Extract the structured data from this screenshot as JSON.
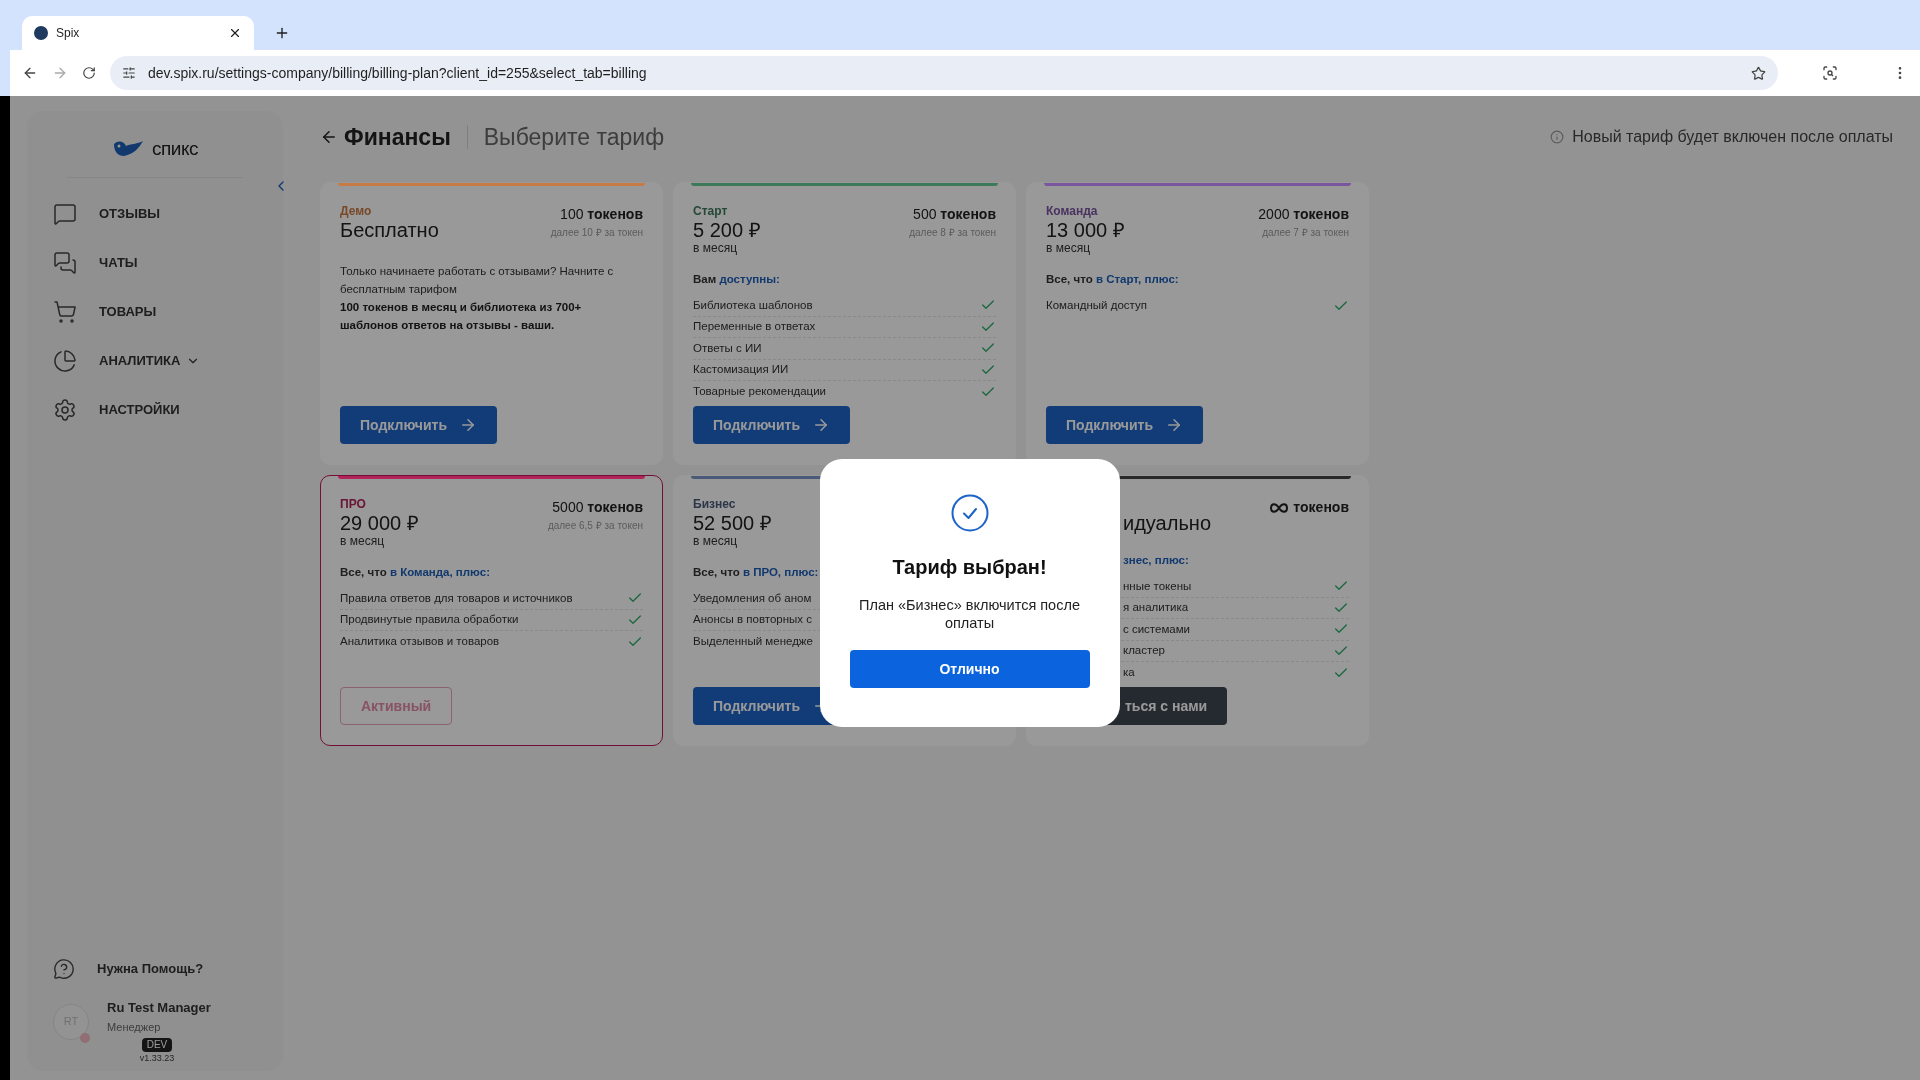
{
  "browser": {
    "tab_title": "Spix",
    "url": "dev.spix.ru/settings-company/billing/billing-plan?client_id=255&select_tab=billing"
  },
  "sidebar": {
    "logo": "спикс",
    "items": [
      {
        "label": "ОТЗЫВЫ",
        "expandable": false
      },
      {
        "label": "ЧАТЫ",
        "expandable": false
      },
      {
        "label": "ТОВАРЫ",
        "expandable": false
      },
      {
        "label": "АНАЛИТИКА",
        "expandable": true
      },
      {
        "label": "НАСТРОЙКИ",
        "expandable": false
      }
    ],
    "help": "Нужна Помощь?",
    "user": {
      "initials": "RT",
      "name": "Ru Test Manager",
      "role": "Менеджер"
    },
    "env": "DEV",
    "version": "v1.33.23"
  },
  "header": {
    "title": "Финансы",
    "subtitle": "Выберите тариф",
    "notice": "Новый тариф будет включен после оплаты"
  },
  "plans": [
    {
      "name": "Демо",
      "color": "#c87a45",
      "price": "Бесплатно",
      "tokens": "100",
      "tokens_label": "токенов",
      "rate": "далее 10 ₽ за токен",
      "description": "Только начинаете работать с отзывами? Начните с бесплатным тарифом",
      "description_bold": "100 токенов в месяц и библиотека из 700+ шаблонов ответов на отзывы - ваши.",
      "button": {
        "label": "Подключить",
        "kind": "primary"
      },
      "selected": false
    },
    {
      "name": "Старт",
      "color": "#3d7a5a",
      "price": "5 200 ₽",
      "period": "в месяц",
      "tokens": "500",
      "tokens_label": "токенов",
      "rate": "далее 8 ₽ за токен",
      "intro": {
        "prefix": "Вам",
        "highlight": "доступны:"
      },
      "features": [
        "Библиотека шаблонов",
        "Переменные в ответах",
        "Ответы с ИИ",
        "Кастомизация ИИ",
        "Товарные рекомендации"
      ],
      "button": {
        "label": "Подключить",
        "kind": "primary"
      },
      "selected": false
    },
    {
      "name": "Команда",
      "color": "#7a55a0",
      "price": "13 000 ₽",
      "period": "в месяц",
      "tokens": "2000",
      "tokens_label": "токенов",
      "rate": "далее 7 ₽ за токен",
      "intro": {
        "prefix": "Все, что",
        "highlight": "в Старт, плюс:"
      },
      "features": [
        "Командный доступ"
      ],
      "button": {
        "label": "Подключить",
        "kind": "primary"
      },
      "selected": false
    },
    {
      "name": "ПРО",
      "color": "#b0245a",
      "price": "29 000 ₽",
      "period": "в месяц",
      "tokens": "5000",
      "tokens_label": "токенов",
      "rate": "далее 6,5 ₽ за токен",
      "intro": {
        "prefix": "Все, что",
        "highlight": "в Команда, плюс:"
      },
      "features": [
        "Правила ответов для товаров и источников",
        "Продвинутые правила обработки",
        "Аналитика отзывов и товаров"
      ],
      "button": {
        "label": "Активный",
        "kind": "outline"
      },
      "selected": true
    },
    {
      "name": "Бизнес",
      "color": "#4a5a78",
      "price": "52 500 ₽",
      "period": "в месяц",
      "intro": {
        "prefix": "Все, что",
        "highlight": "в ПРО, плюс:"
      },
      "features": [
        "Уведомления об аном",
        "Анонсы в повторных с",
        "Выделенный менедже"
      ],
      "button": {
        "label": "Подключить",
        "kind": "primary"
      },
      "selected": false
    },
    {
      "color": "#2a2a2a",
      "price": "идуально",
      "tokens_label": "токенов",
      "unlimited": true,
      "intro": {
        "highlight": "знес, плюс:"
      },
      "features": [
        "нные токены",
        "я аналитика",
        "с системами",
        "кластер",
        "ка"
      ],
      "button": {
        "label": "ться с нами",
        "kind": "dark"
      },
      "selected": false
    }
  ],
  "dialog": {
    "title": "Тариф выбран!",
    "message": "План «Бизнес» включится после оплаты",
    "button": "Отлично"
  }
}
